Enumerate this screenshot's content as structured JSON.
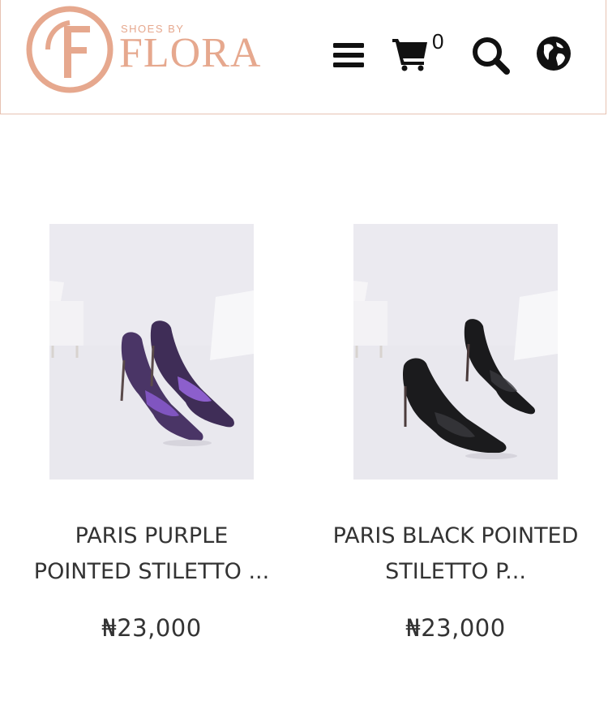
{
  "header": {
    "logo_tagline": "SHOES BY",
    "logo_word": "FLORA",
    "cart_count": "0",
    "icons": [
      "menu-icon",
      "cart-icon",
      "search-icon",
      "globe-icon"
    ]
  },
  "products": [
    {
      "title_line1": "PARIS PURPLE",
      "title_line2": "POINTED STILETTO ...",
      "price": "₦23,000",
      "image_alt": "purple stiletto mules"
    },
    {
      "title_line1": "PARIS BLACK POINTED",
      "title_line2": "STILETTO P...",
      "price": "₦23,000",
      "image_alt": "black stiletto mules"
    }
  ],
  "colors": {
    "brand": "#e6a88e",
    "border": "#e7c2b2",
    "text": "#333333",
    "icon": "#111111"
  }
}
